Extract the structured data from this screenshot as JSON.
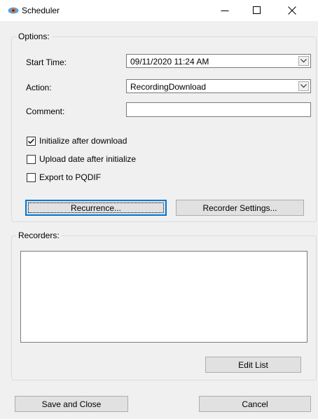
{
  "window": {
    "title": "Scheduler"
  },
  "options": {
    "group_label": "Options:",
    "start_time_label": "Start Time:",
    "start_time_value": "09/11/2020 11:24 AM",
    "action_label": "Action:",
    "action_value": "RecordingDownload",
    "comment_label": "Comment:",
    "comment_value": "",
    "checkboxes": [
      {
        "label": "Initialize after download",
        "checked": true
      },
      {
        "label": "Upload date after initialize",
        "checked": false
      },
      {
        "label": "Export to PQDIF",
        "checked": false
      }
    ],
    "recurrence_label": "Recurrence...",
    "recorder_settings_label": "Recorder Settings..."
  },
  "recorders": {
    "group_label": "Recorders:",
    "items": [],
    "edit_list_label": "Edit List"
  },
  "footer": {
    "save_close_label": "Save and Close",
    "cancel_label": "Cancel"
  }
}
